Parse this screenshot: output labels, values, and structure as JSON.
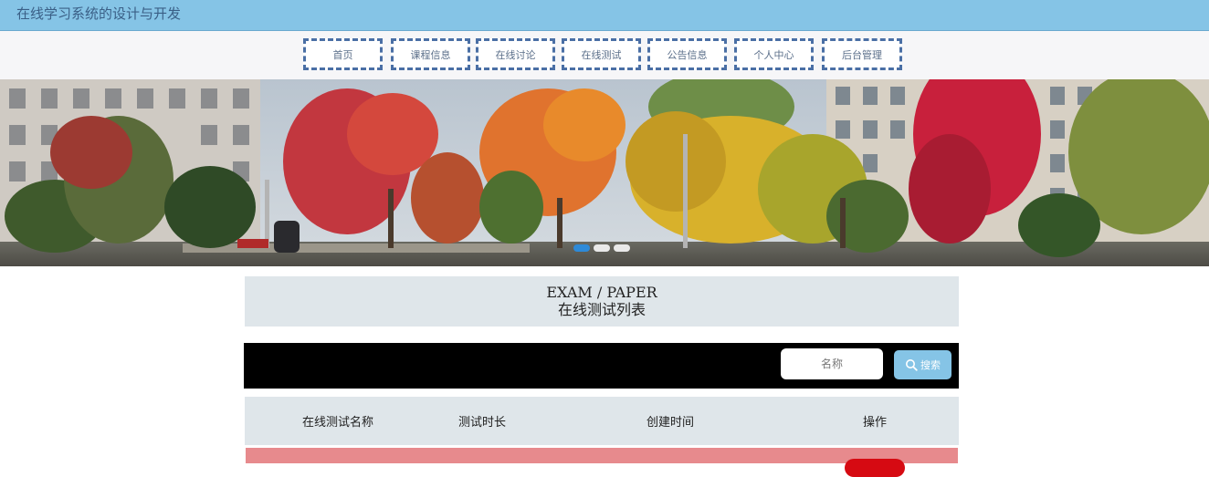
{
  "header": {
    "site_title": "在线学习系统的设计与开发"
  },
  "nav": {
    "items": [
      {
        "label": "首页"
      },
      {
        "label": "课程信息"
      },
      {
        "label": "在线讨论"
      },
      {
        "label": "在线测试"
      },
      {
        "label": "公告信息"
      },
      {
        "label": "个人中心"
      },
      {
        "label": "后台管理"
      }
    ]
  },
  "carousel": {
    "slides": 3,
    "active_index": 0
  },
  "section": {
    "title_en": "EXAM / PAPER",
    "title_cn": "在线测试列表"
  },
  "search": {
    "placeholder": "名称",
    "button_label": "搜索"
  },
  "table": {
    "headers": [
      "在线测试名称",
      "测试时长",
      "创建时间",
      "操作"
    ]
  },
  "colors": {
    "accent": "#85c4e6",
    "nav_border": "#4a6fa5",
    "panel": "#dfe6ea",
    "row_highlight": "#e78a8d",
    "danger": "#d60a12"
  }
}
